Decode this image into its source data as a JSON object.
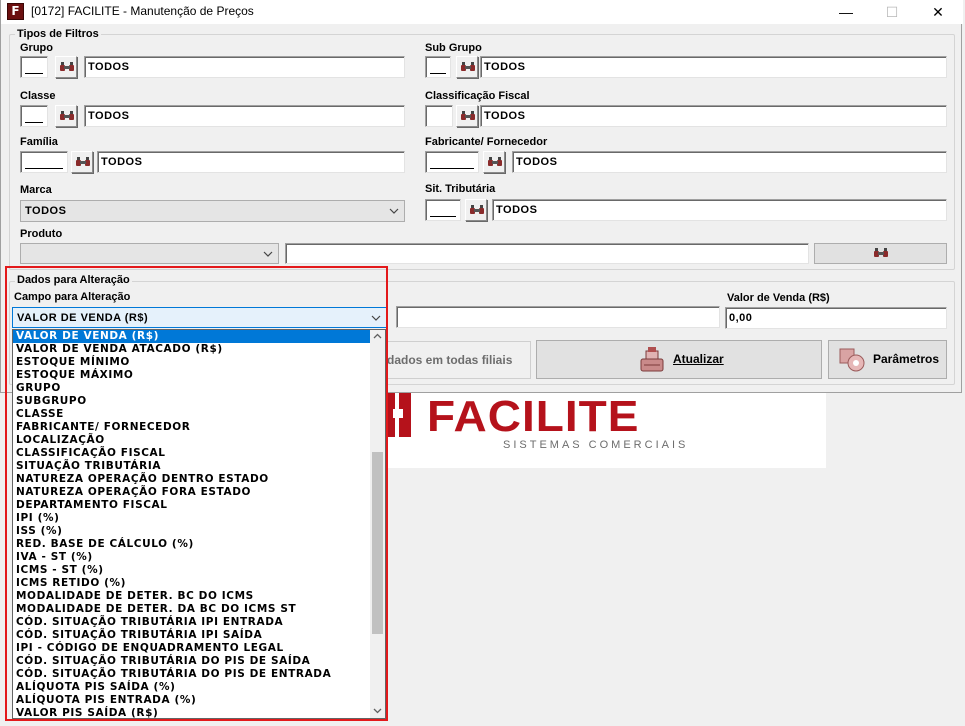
{
  "window": {
    "title": "[0172] FACILITE - Manutenção de Preços",
    "icon_letter": "F",
    "minimize": "—",
    "maximize": "☐",
    "close": "✕"
  },
  "filters": {
    "legend": "Tipos de Filtros",
    "grupo": {
      "label": "Grupo",
      "code": "",
      "value": "TODOS"
    },
    "sub_grupo": {
      "label": "Sub Grupo",
      "code": "",
      "value": "TODOS"
    },
    "classe": {
      "label": "Classe",
      "code": "",
      "value": "TODOS"
    },
    "classificacao_fiscal": {
      "label": "Classificação Fiscal",
      "code": "",
      "value": "TODOS"
    },
    "familia": {
      "label": "Família",
      "code": "",
      "value": "TODOS"
    },
    "fabricante": {
      "label": "Fabricante/ Fornecedor",
      "code": "",
      "value": "TODOS"
    },
    "marca": {
      "label": "Marca",
      "selected": "TODOS"
    },
    "sit_tributaria": {
      "label": "Sit. Tributária",
      "code": "",
      "value": "TODOS"
    },
    "produto": {
      "label": "Produto",
      "selected": "",
      "value": ""
    }
  },
  "alteracao": {
    "legend": "Dados para Alteração",
    "campo_label": "Campo para Alteração",
    "campo_selected": "VALOR DE VENDA (R$)",
    "valor_label": "Valor de Venda (R$)",
    "valor_value": "0,00",
    "filiais_text": "dados em todas filiais",
    "atualizar_label": "Atualizar",
    "parametros_label": "Parâmetros"
  },
  "dropdown_items": [
    "VALOR DE VENDA (R$)",
    "VALOR DE VENDA ATACADO (R$)",
    "ESTOQUE MÍNIMO",
    "ESTOQUE MÁXIMO",
    "GRUPO",
    "SUBGRUPO",
    "CLASSE",
    "FABRICANTE/ FORNECEDOR",
    "LOCALIZAÇÃO",
    "CLASSIFICAÇÃO FISCAL",
    "SITUAÇÃO TRIBUTÁRIA",
    "NATUREZA OPERAÇÃO DENTRO ESTADO",
    "NATUREZA OPERAÇÃO FORA ESTADO",
    "DEPARTAMENTO FISCAL",
    "IPI (%)",
    "ISS (%)",
    "RED. BASE DE CÁLCULO (%)",
    "IVA - ST (%)",
    "ICMS - ST (%)",
    "ICMS RETIDO (%)",
    "MODALIDADE DE DETER. BC DO ICMS",
    "MODALIDADE DE DETER. DA BC DO ICMS ST",
    "CÓD. SITUAÇÃO TRIBUTÁRIA IPI ENTRADA",
    "CÓD. SITUAÇÃO TRIBUTÁRIA IPI SAÍDA",
    "IPI - CÓDIGO DE ENQUADRAMENTO LEGAL",
    "CÓD. SITUAÇÃO TRIBUTÁRIA DO PIS DE SAÍDA",
    "CÓD. SITUAÇÃO TRIBUTÁRIA DO PIS DE ENTRADA",
    "ALÍQUOTA PIS SAÍDA (%)",
    "ALÍQUOTA PIS ENTRADA (%)",
    "VALOR PIS SAÍDA (R$)"
  ],
  "logo": {
    "brand": "FACILITE",
    "tagline": "SISTEMAS COMERCIAIS"
  },
  "colors": {
    "brand_red": "#b5121b",
    "selection": "#0078d7",
    "highlight": "#e3191b"
  }
}
